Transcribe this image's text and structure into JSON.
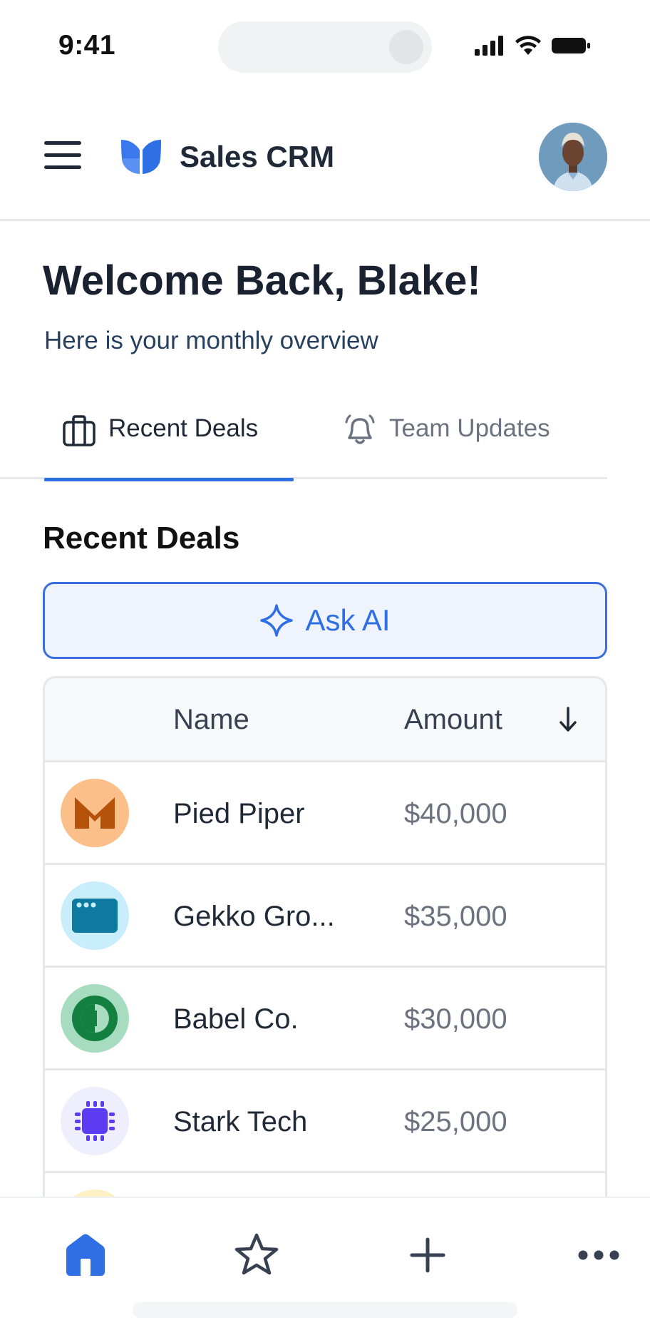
{
  "status_bar": {
    "time": "9:41"
  },
  "header": {
    "title": "Sales CRM",
    "avatar_icon": "user-avatar",
    "brand_color": "#2f6fe4"
  },
  "welcome": {
    "title": "Welcome Back, Blake!",
    "subtitle": "Here is your monthly overview"
  },
  "tabs": [
    {
      "label": "Recent Deals",
      "icon": "briefcase-icon",
      "active": true
    },
    {
      "label": "Team Updates",
      "icon": "bell-icon",
      "active": false
    }
  ],
  "section": {
    "title": "Recent Deals",
    "ask_ai_label": "Ask AI"
  },
  "table": {
    "columns": {
      "name": "Name",
      "amount": "Amount",
      "sort_icon": "arrow-down-icon"
    },
    "rows": [
      {
        "name": "Pied Piper",
        "amount": "$40,000",
        "logo_color": "#fbbf8a"
      },
      {
        "name": "Gekko Gro...",
        "amount": "$35,000",
        "logo_color": "#c7eefa"
      },
      {
        "name": "Babel Co.",
        "amount": "$30,000",
        "logo_color": "#a7dcc0"
      },
      {
        "name": "Stark Tech",
        "amount": "$25,000",
        "logo_color": "#eeeefc"
      }
    ]
  },
  "bottom_nav": [
    {
      "icon": "home-icon",
      "active": true
    },
    {
      "icon": "star-icon",
      "active": false
    },
    {
      "icon": "plus-icon",
      "active": false
    },
    {
      "icon": "more-icon",
      "active": false
    }
  ]
}
